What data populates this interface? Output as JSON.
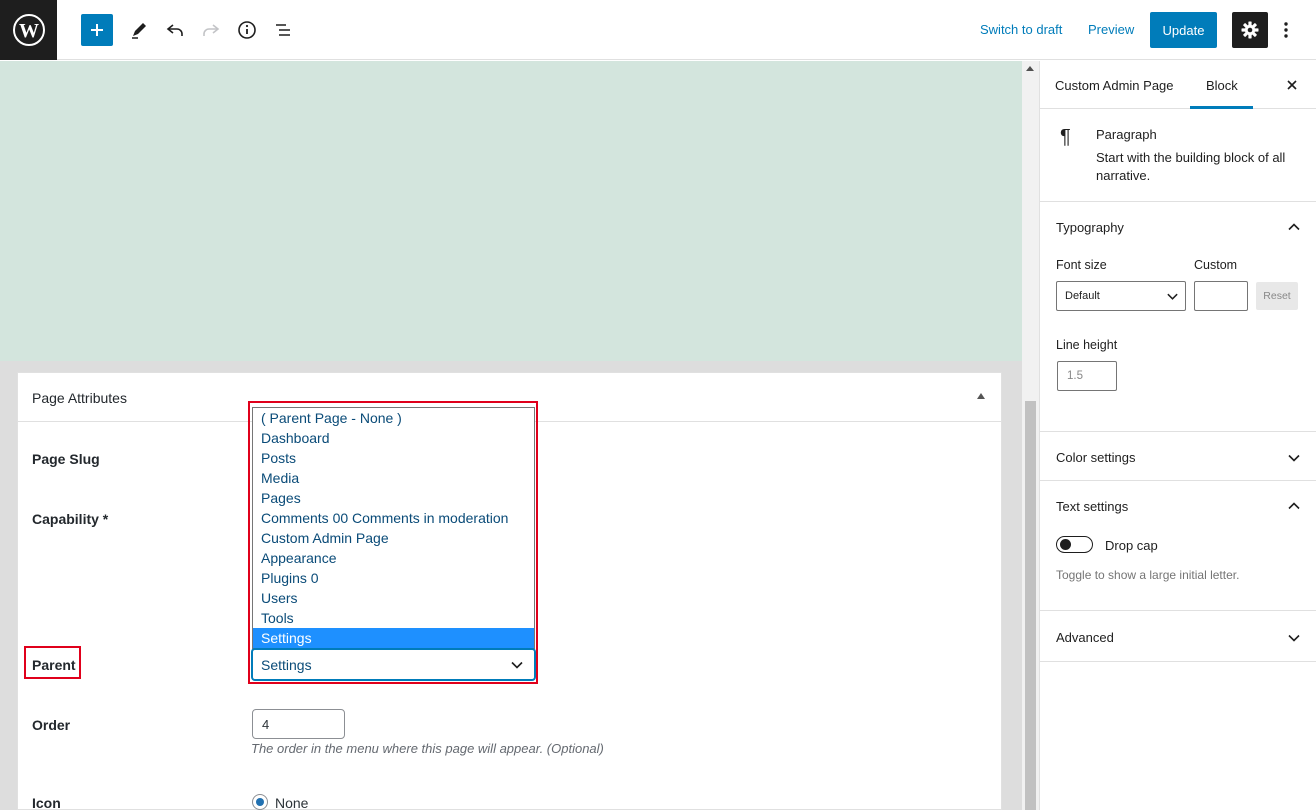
{
  "toolbar": {
    "switch_to_draft": "Switch to draft",
    "preview": "Preview",
    "update": "Update",
    "icons": [
      "wordpress-logo",
      "plus-icon",
      "pencil-icon",
      "undo-icon",
      "redo-icon",
      "info-icon",
      "list-view-icon",
      "gear-icon",
      "more-vertical-icon"
    ]
  },
  "page_attributes": {
    "title": "Page Attributes",
    "slug_label": "Page Slug",
    "capability_label": "Capability *",
    "parent_label": "Parent",
    "order_label": "Order",
    "icon_label": "Icon",
    "parent_options": [
      "( Parent Page - None )",
      "Dashboard",
      "Posts",
      "Media",
      "Pages",
      "Comments 00 Comments in moderation",
      "Custom Admin Page",
      "Appearance",
      "Plugins 0",
      "Users",
      "Tools",
      "Settings"
    ],
    "parent_selected": "Settings",
    "order_value": "4",
    "order_help": "The order in the menu where this page will appear. (Optional)",
    "icon_option": "None"
  },
  "sidebar": {
    "tab_document": "Custom Admin Page",
    "tab_block": "Block",
    "block_title": "Paragraph",
    "block_icon": "¶",
    "block_desc": "Start with the building block of all narrative.",
    "typography_title": "Typography",
    "font_size_label": "Font size",
    "custom_label": "Custom",
    "font_size_value": "Default",
    "reset_label": "Reset",
    "line_height_label": "Line height",
    "line_height_placeholder": "1.5",
    "color_settings_title": "Color settings",
    "text_settings_title": "Text settings",
    "drop_cap_label": "Drop cap",
    "drop_cap_help": "Toggle to show a large initial letter.",
    "advanced_title": "Advanced"
  },
  "colors": {
    "accent": "#007cba",
    "highlight": "#e0001b",
    "canvas": "#d3e5dd",
    "selected_option": "#1e90ff"
  }
}
